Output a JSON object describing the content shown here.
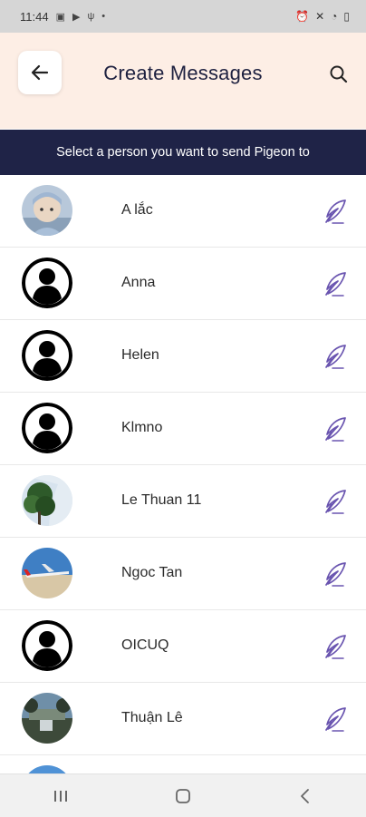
{
  "status_bar": {
    "time": "11:44"
  },
  "header": {
    "title": "Create Messages"
  },
  "banner": {
    "text": "Select a person you want to send Pigeon to"
  },
  "contacts": [
    {
      "name": "A lắc",
      "avatar": "photo-baby"
    },
    {
      "name": "Anna",
      "avatar": "default-user"
    },
    {
      "name": "Helen",
      "avatar": "default-user"
    },
    {
      "name": "Klmno",
      "avatar": "default-user"
    },
    {
      "name": "Le Thuan 11",
      "avatar": "photo-tree"
    },
    {
      "name": "Ngoc Tan",
      "avatar": "photo-airplane"
    },
    {
      "name": "OICUQ",
      "avatar": "default-user"
    },
    {
      "name": "Thuận Lê",
      "avatar": "photo-lake"
    },
    {
      "name": "",
      "avatar": "photo-sky"
    }
  ],
  "colors": {
    "header_bg": "#fdeee5",
    "banner_bg": "#1f2347",
    "quill": "#6a55b0"
  },
  "icons": {
    "back": "arrow-left-icon",
    "search": "search-icon",
    "send": "quill-icon"
  }
}
